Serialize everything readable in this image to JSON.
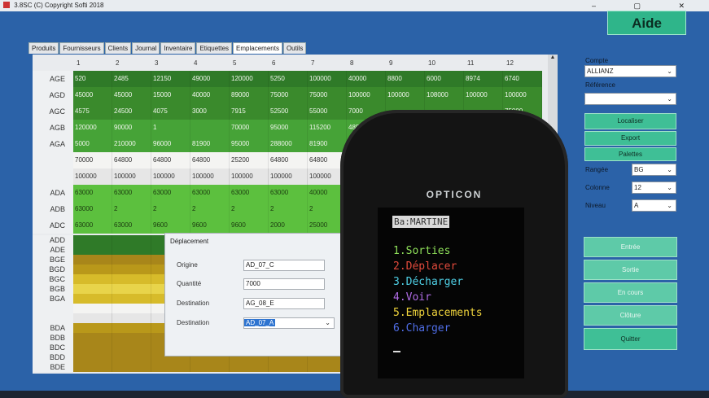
{
  "window": {
    "title": "3.8SC (C) Copyright Softi 2018"
  },
  "aide_label": "Aide",
  "tabs": [
    "Produits",
    "Fournisseurs",
    "Clients",
    "Journal",
    "Inventaire",
    "Etiquettes",
    "Emplacements",
    "Outils"
  ],
  "columns": [
    "1",
    "2",
    "3",
    "4",
    "5",
    "6",
    "7",
    "8",
    "9",
    "10",
    "11",
    "12"
  ],
  "rows": [
    {
      "label": "AGE",
      "cells": [
        "520",
        "2485",
        "12150",
        "49000",
        "120000",
        "5250",
        "100000",
        "40000",
        "8800",
        "6000",
        "8974",
        "6740"
      ]
    },
    {
      "label": "AGD",
      "cells": [
        "45000",
        "45000",
        "15000",
        "40000",
        "89000",
        "75000",
        "75000",
        "100000",
        "100000",
        "108000",
        "100000",
        "100000"
      ]
    },
    {
      "label": "AGC",
      "cells": [
        "4575",
        "24500",
        "4075",
        "3000",
        "7915",
        "52500",
        "55000",
        "7000",
        "",
        "",
        "",
        "75000"
      ]
    },
    {
      "label": "AGB",
      "cells": [
        "120000",
        "90000",
        "1",
        "",
        "70000",
        "95000",
        "115200",
        "4850",
        "",
        "",
        "",
        ""
      ]
    },
    {
      "label": "AGA",
      "cells": [
        "5000",
        "210000",
        "96000",
        "81900",
        "95000",
        "288000",
        "81900",
        "819",
        "",
        "",
        "",
        ""
      ]
    },
    {
      "label": "",
      "cells": [
        "70000",
        "64800",
        "64800",
        "64800",
        "25200",
        "64800",
        "64800",
        "",
        "",
        "",
        "",
        ""
      ]
    },
    {
      "label": "",
      "cells": [
        "100000",
        "100000",
        "100000",
        "100000",
        "100000",
        "100000",
        "100000",
        "",
        "",
        "",
        "",
        ""
      ]
    },
    {
      "label": "ADA",
      "cells": [
        "63000",
        "63000",
        "63000",
        "63000",
        "63000",
        "63000",
        "40000",
        "",
        "",
        "",
        "",
        ""
      ]
    },
    {
      "label": "ADB",
      "cells": [
        "63000",
        "2",
        "2",
        "2",
        "2",
        "2",
        "2",
        "",
        "",
        "",
        "",
        ""
      ]
    },
    {
      "label": "ADC",
      "cells": [
        "63000",
        "63000",
        "9600",
        "9600",
        "9600",
        "2000",
        "25000",
        "",
        "",
        "",
        "",
        ""
      ]
    }
  ],
  "small_rows": [
    "ADD",
    "ADE",
    "BGE",
    "BGD",
    "BGC",
    "BGB",
    "BGA",
    "",
    "",
    "BDA",
    "BDB",
    "BDC",
    "BDD",
    "BDE"
  ],
  "dialog": {
    "title": "Déplacement",
    "origine_label": "Origine",
    "origine_value": "AD_07_C",
    "quantite_label": "Quantité",
    "quantite_value": "7000",
    "destination_label": "Destination",
    "destination_value": "AG_08_E",
    "destination2_label": "Destination",
    "destination2_value": "AD_07_A"
  },
  "panel": {
    "compte_label": "Compte",
    "compte_value": "ALLIANZ",
    "reference_label": "Référence",
    "reference_value": "",
    "localiser": "Localiser",
    "export": "Export",
    "palettes": "Palettes",
    "rangee_label": "Rangée",
    "rangee_value": "BG",
    "colonne_label": "Colonne",
    "colonne_value": "12",
    "niveau_label": "Niveau",
    "niveau_value": "A",
    "entree": "Entrée",
    "sortie": "Sortie",
    "en_cours": "En cours",
    "cloture": "Clôture",
    "quitter": "Quitter"
  },
  "device": {
    "brand": "OPTICON",
    "user": "Ba:MARTINE",
    "menu": [
      {
        "text": "1.Sorties",
        "color": "#8fe05a"
      },
      {
        "text": "2.Déplacer",
        "color": "#e24a3c"
      },
      {
        "text": "3.Décharger",
        "color": "#4fd0e6"
      },
      {
        "text": "4.Voir",
        "color": "#b06ce6"
      },
      {
        "text": "5.Emplacements",
        "color": "#f0d43c"
      },
      {
        "text": "6.Charger",
        "color": "#4f6de6"
      }
    ]
  }
}
